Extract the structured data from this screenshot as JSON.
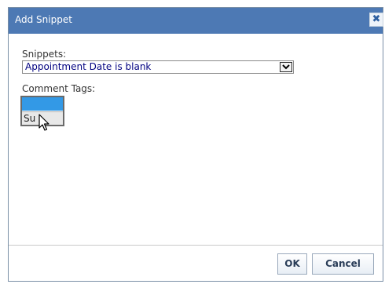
{
  "dialog": {
    "title": "Add Snippet",
    "close_symbol": "✖"
  },
  "snippets": {
    "label": "Snippets:",
    "selected_value": "Appointment Date is blank"
  },
  "comment_tags": {
    "label": "Comment Tags:",
    "items": [
      "",
      "Su"
    ]
  },
  "buttons": {
    "ok": "OK",
    "cancel": "Cancel"
  },
  "colors": {
    "titlebar": "#4d79b4",
    "selected_item": "#3399e6"
  },
  "icons": {
    "close": "close-icon",
    "dropdown": "chevron-down-icon",
    "cursor": "mouse-pointer-icon"
  }
}
